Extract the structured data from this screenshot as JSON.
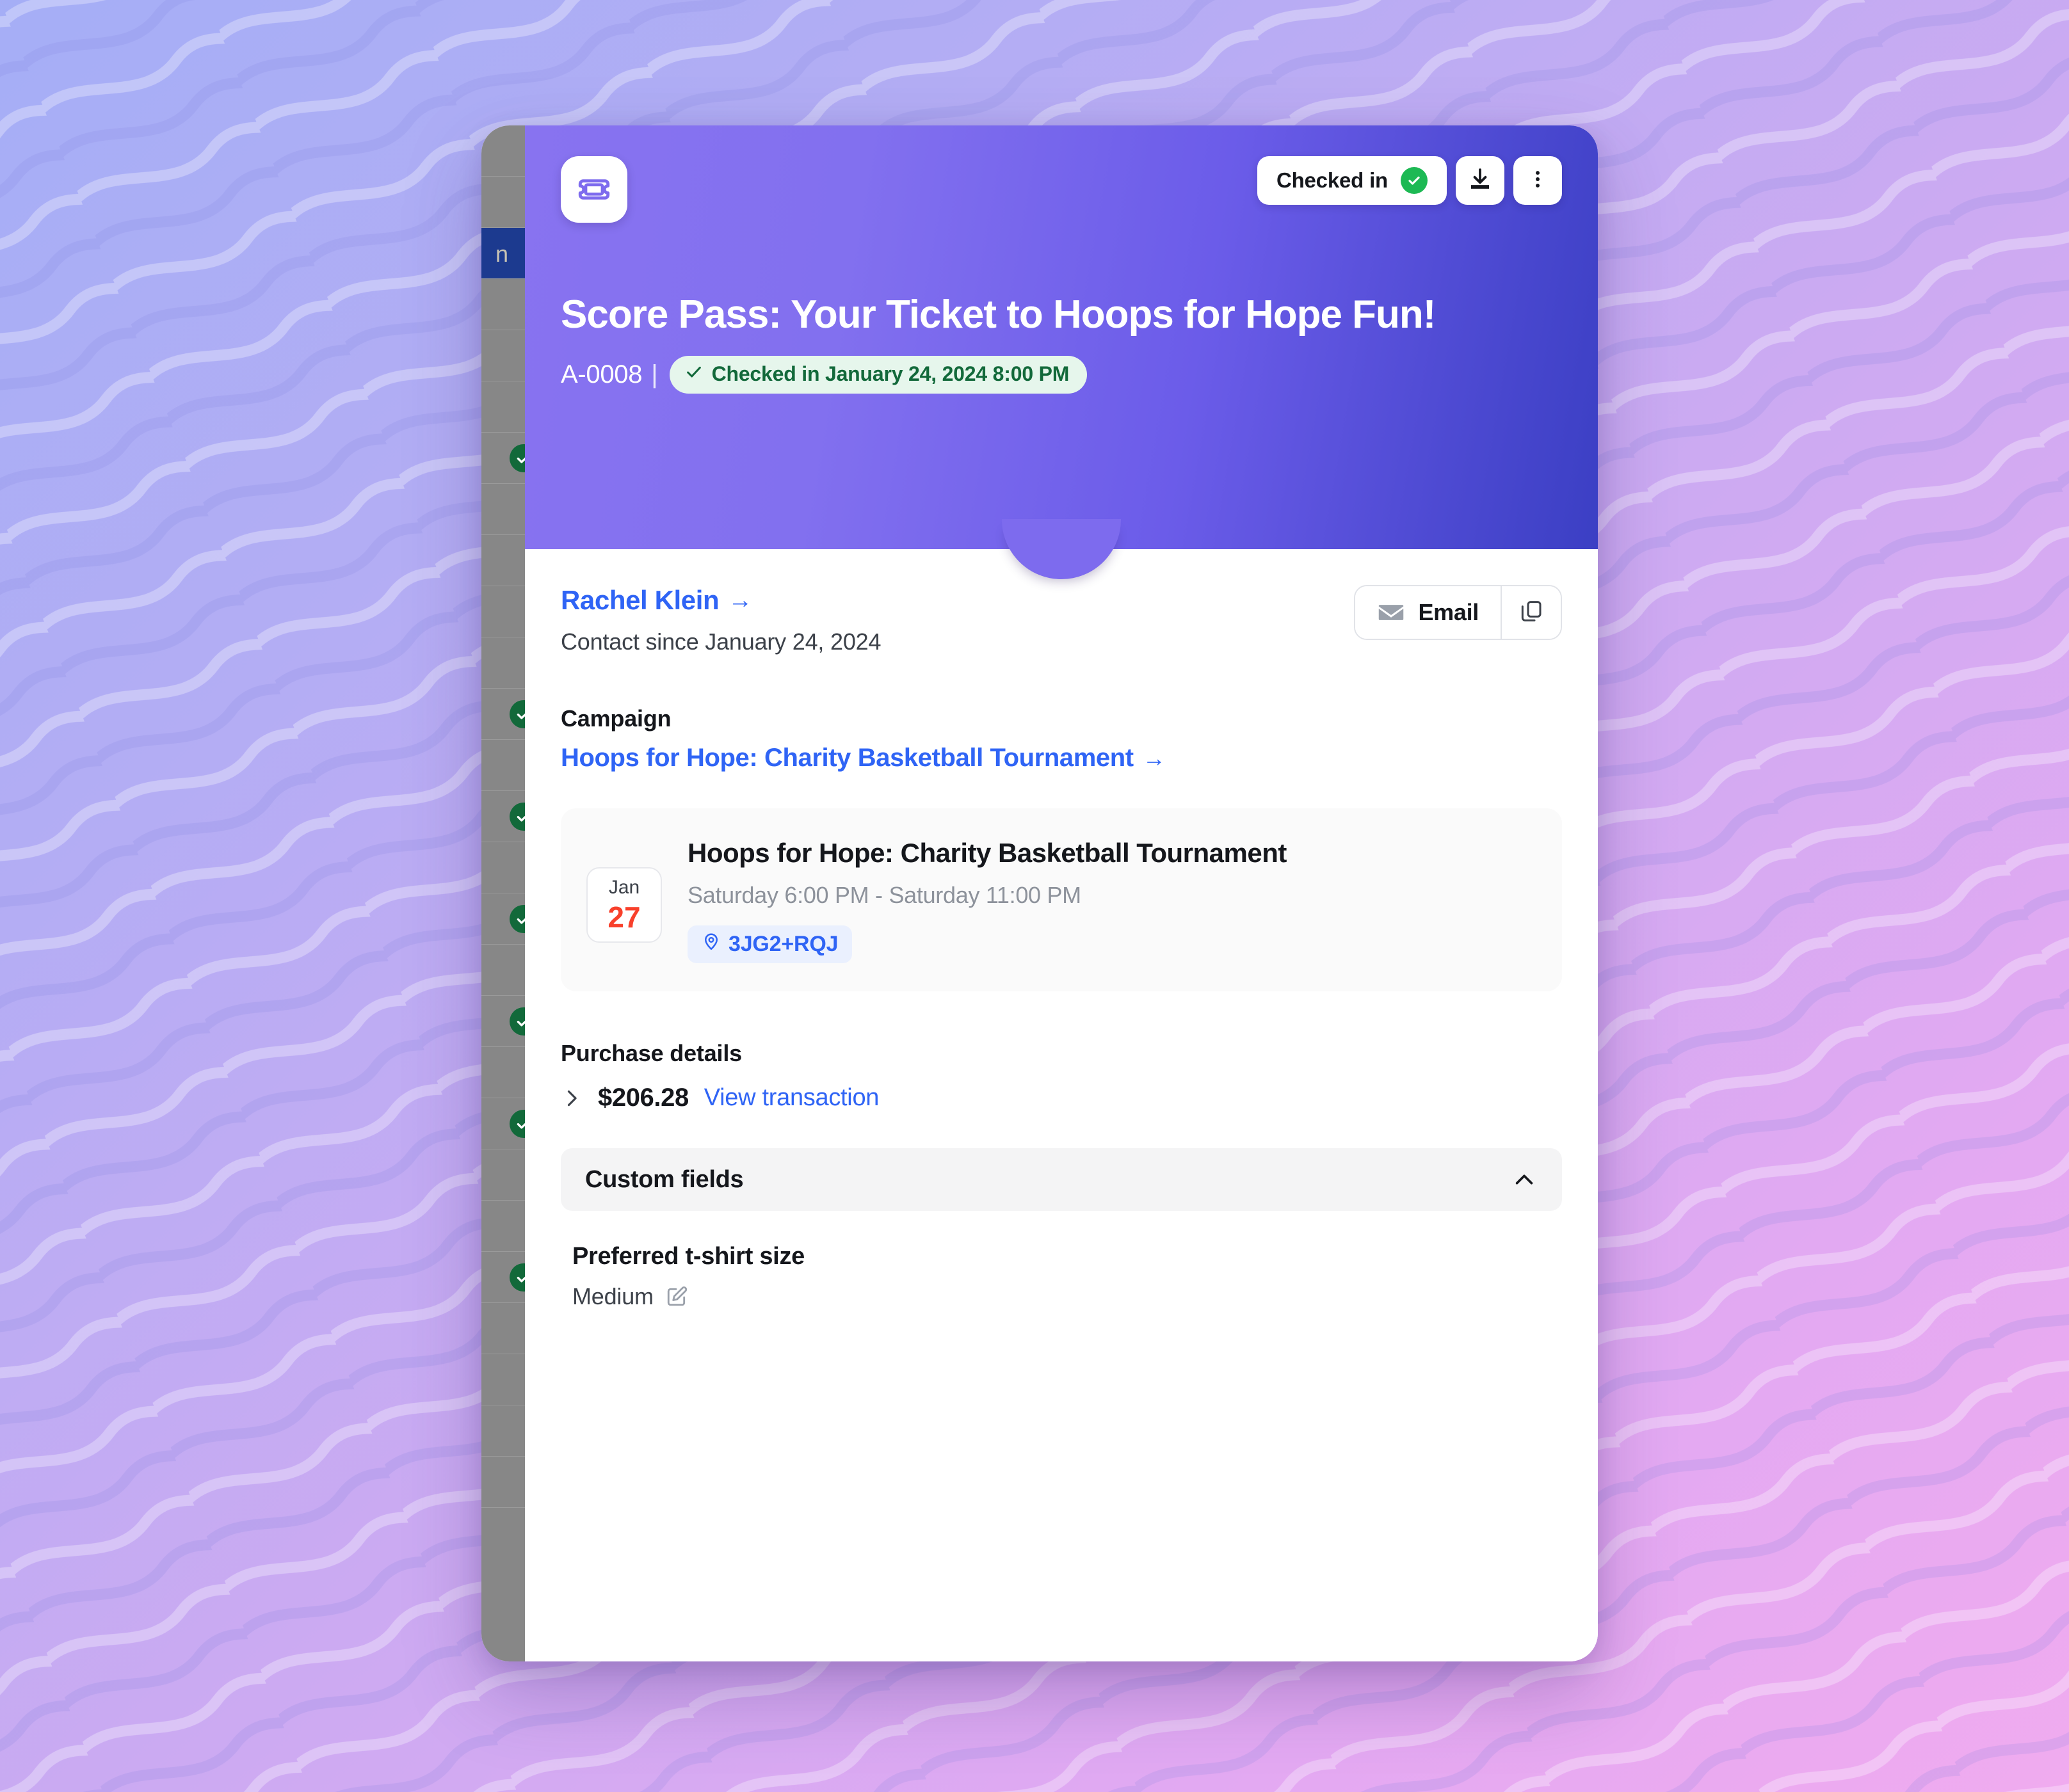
{
  "background": {
    "gradient_start": "#a8b0f5",
    "gradient_end": "#eeaaf0",
    "pattern": "diagonal-wavy-stripes"
  },
  "header": {
    "icon": "ticket-icon",
    "accent_color": "#7d6bee",
    "status_button": {
      "label": "Checked in",
      "icon": "check-circle-icon",
      "badge_color": "#1db954"
    },
    "download_button": {
      "icon": "download-icon"
    },
    "more_button": {
      "icon": "kebab-menu-icon"
    },
    "title": "Score Pass: Your Ticket to Hoops for Hope Fun!",
    "ticket_code": "A-0008",
    "divider": "|",
    "checkin_chip": {
      "icon": "check-icon",
      "label": "Checked in January 24, 2024 8:00 PM",
      "text_color": "#12693a",
      "background_color": "#e6f6ec"
    }
  },
  "contact": {
    "name": "Rachel Klein",
    "name_arrow": "→",
    "since": "Contact since January 24, 2024",
    "email_button": {
      "label": "Email",
      "icon": "envelope-icon"
    },
    "copy_button": {
      "icon": "copy-icon"
    }
  },
  "campaign": {
    "label": "Campaign",
    "link": "Hoops for Hope: Charity Basketball Tournament",
    "link_arrow": "→"
  },
  "event": {
    "date_month": "Jan",
    "date_day": "27",
    "title": "Hoops for Hope: Charity Basketball Tournament",
    "time": "Saturday 6:00 PM - Saturday 11:00 PM",
    "location": {
      "icon": "map-pin-icon",
      "code": "3JG2+RQJ"
    }
  },
  "purchase": {
    "label": "Purchase details",
    "expand_icon": "chevron-right-icon",
    "amount": "$206.28",
    "view_link": "View transaction"
  },
  "custom_fields": {
    "section_title": "Custom fields",
    "collapse_icon": "chevron-up-icon",
    "fields": [
      {
        "name": "Preferred t-shirt size",
        "value": "Medium",
        "edit_icon": "edit-pencil-icon"
      }
    ]
  },
  "backdrop_table": {
    "selected_row_text": "n",
    "selected_row_color": "#1c3a8f",
    "check_icon": "check-circle-icon",
    "check_color": "#12693a"
  }
}
